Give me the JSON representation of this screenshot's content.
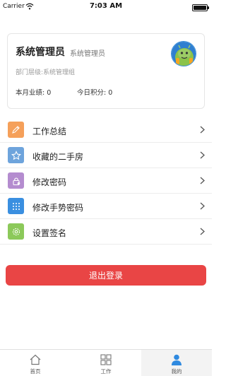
{
  "status_bar": {
    "carrier": "Carrier",
    "time": "7:03 AM"
  },
  "profile": {
    "name": "系统管理员",
    "role": "系统管理员",
    "department": "部门层级:系统管理组",
    "performance": "本月业绩: 0",
    "points": "今日积分: 0"
  },
  "menu": {
    "items": [
      {
        "label": "工作总结",
        "icon": "pencil-icon",
        "color": "#f5a05a"
      },
      {
        "label": "收藏的二手房",
        "icon": "star-icon",
        "color": "#6ea4dc"
      },
      {
        "label": "修改密码",
        "icon": "lock-icon",
        "color": "#b48ccf"
      },
      {
        "label": "修改手势密码",
        "icon": "gesture-grid-icon",
        "color": "#3a8fe0"
      },
      {
        "label": "设置签名",
        "icon": "gear-icon",
        "color": "#8cc95a"
      }
    ]
  },
  "logout": {
    "label": "退出登录",
    "color": "#e94545"
  },
  "tab_bar": {
    "tabs": [
      {
        "label": "首页",
        "icon": "home-icon"
      },
      {
        "label": "工作",
        "icon": "grid-icon"
      },
      {
        "label": "我的",
        "icon": "user-icon",
        "active": true
      }
    ]
  }
}
